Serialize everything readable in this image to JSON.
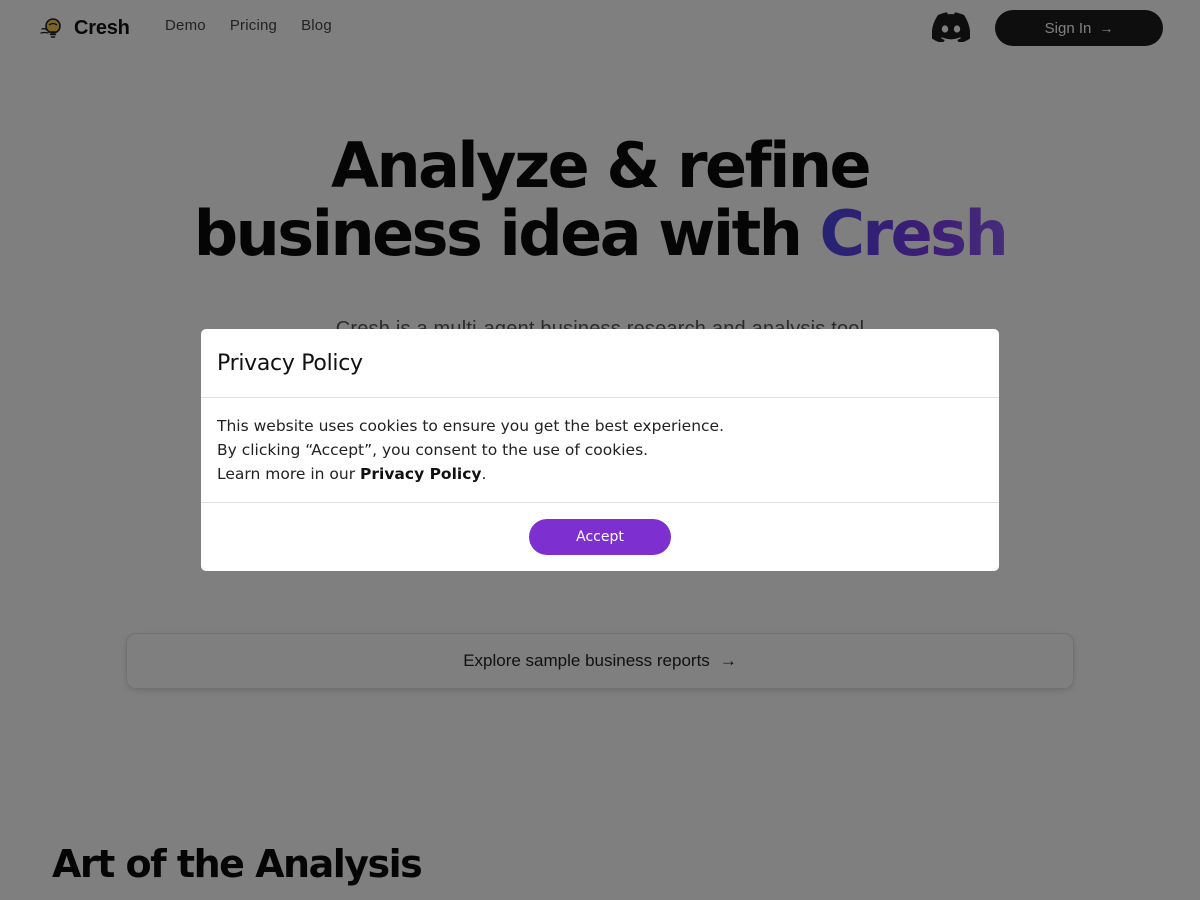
{
  "brand": {
    "name": "Cresh",
    "logo_icon": "lightbulb-icon"
  },
  "nav": {
    "items": [
      "Demo",
      "Pricing",
      "Blog"
    ]
  },
  "header": {
    "discord_icon": "discord-icon",
    "signin_label": "Sign In",
    "signin_arrow": "→"
  },
  "hero": {
    "title_line1": "Analyze & refine",
    "title_line2_prefix": "business idea with ",
    "title_brand": "Cresh",
    "subtitle": "Cresh is a multi-agent business research and analysis tool"
  },
  "explore": {
    "label": "Explore sample business reports",
    "arrow": "→"
  },
  "section": {
    "title": "Art of the Analysis"
  },
  "modal": {
    "title": "Privacy Policy",
    "line1": "This website uses cookies to ensure you get the best experience.",
    "line2": "By clicking “Accept”, you consent to the use of cookies.",
    "line3_prefix": "Learn more in our ",
    "line3_link": "Privacy Policy",
    "line3_suffix": ".",
    "accept_label": "Accept"
  },
  "colors": {
    "accent": "#7e2fd0",
    "brand_gradient_start": "#4f46e5",
    "brand_gradient_end": "#8b5cf6",
    "signin_bg": "#1c1c1c"
  }
}
